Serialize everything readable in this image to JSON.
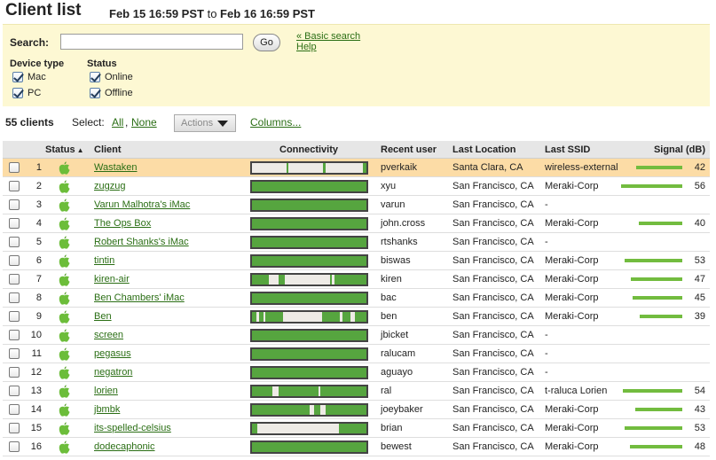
{
  "header": {
    "title": "Client list",
    "date_from": "Feb 15 16:59 PST",
    "date_sep": "to",
    "date_to": "Feb 16 16:59 PST"
  },
  "search": {
    "label": "Search:",
    "value": "",
    "go_label": "Go",
    "basic_search_link": "« Basic search",
    "help_link": "Help"
  },
  "filters": {
    "device_type": {
      "title": "Device type",
      "options": [
        {
          "label": "Mac",
          "checked": true
        },
        {
          "label": "PC",
          "checked": true
        }
      ]
    },
    "status": {
      "title": "Status",
      "options": [
        {
          "label": "Online",
          "checked": true
        },
        {
          "label": "Offline",
          "checked": true
        }
      ]
    }
  },
  "toolbar": {
    "count": "55 clients",
    "select_label": "Select:",
    "select_all": "All",
    "select_none": "None",
    "actions_label": "Actions",
    "columns_link": "Columns..."
  },
  "columns": {
    "status": "Status",
    "sort_arrow": "▲",
    "client": "Client",
    "connectivity": "Connectivity",
    "recent_user": "Recent user",
    "last_location": "Last Location",
    "last_ssid": "Last SSID",
    "signal": "Signal (dB)"
  },
  "colors": {
    "link": "#2a6e14",
    "online_green": "#56a53f",
    "signal_green": "#72bc3f",
    "selected_row": "#fcdca6",
    "panel": "#fdf8d3"
  },
  "status_icon": "apple-icon",
  "rows": [
    {
      "num": "1",
      "client": "Wastaken",
      "user": "pverkaik",
      "location": "Santa Clara, CA",
      "ssid": "wireless-external",
      "signal": "42",
      "selected": true,
      "gaps": [
        [
          0.0,
          0.3
        ],
        [
          0.32,
          0.62
        ],
        [
          0.64,
          0.97
        ]
      ]
    },
    {
      "num": "2",
      "client": "zugzug",
      "user": "xyu",
      "location": "San Francisco, CA",
      "ssid": "Meraki-Corp",
      "signal": "56",
      "gaps": []
    },
    {
      "num": "3",
      "client": "Varun Malhotra's iMac",
      "user": "varun",
      "location": "San Francisco, CA",
      "ssid": "-",
      "signal": "",
      "gaps": []
    },
    {
      "num": "4",
      "client": "The Ops Box",
      "user": "john.cross",
      "location": "San Francisco, CA",
      "ssid": "Meraki-Corp",
      "signal": "40",
      "gaps": []
    },
    {
      "num": "5",
      "client": "Robert Shanks's iMac",
      "user": "rtshanks",
      "location": "San Francisco, CA",
      "ssid": "-",
      "signal": "",
      "gaps": []
    },
    {
      "num": "6",
      "client": "tintin",
      "user": "biswas",
      "location": "San Francisco, CA",
      "ssid": "Meraki-Corp",
      "signal": "53",
      "gaps": []
    },
    {
      "num": "7",
      "client": "kiren-air",
      "user": "kiren",
      "location": "San Francisco, CA",
      "ssid": "Meraki-Corp",
      "signal": "47",
      "gaps": [
        [
          0.15,
          0.23
        ],
        [
          0.29,
          0.68
        ],
        [
          0.7,
          0.72
        ]
      ]
    },
    {
      "num": "8",
      "client": "Ben Chambers' iMac",
      "user": "bac",
      "location": "San Francisco, CA",
      "ssid": "Meraki-Corp",
      "signal": "45",
      "gaps": []
    },
    {
      "num": "9",
      "client": "Ben",
      "user": "ben",
      "location": "San Francisco, CA",
      "ssid": "Meraki-Corp",
      "signal": "39",
      "gaps": [
        [
          0.04,
          0.06
        ],
        [
          0.1,
          0.12
        ],
        [
          0.27,
          0.61
        ],
        [
          0.77,
          0.79
        ],
        [
          0.86,
          0.9
        ]
      ]
    },
    {
      "num": "10",
      "client": "screen",
      "user": "jbicket",
      "location": "San Francisco, CA",
      "ssid": "-",
      "signal": "",
      "gaps": []
    },
    {
      "num": "11",
      "client": "pegasus",
      "user": "ralucam",
      "location": "San Francisco, CA",
      "ssid": "-",
      "signal": "",
      "gaps": []
    },
    {
      "num": "12",
      "client": "negatron",
      "user": "aguayo",
      "location": "San Francisco, CA",
      "ssid": "-",
      "signal": "",
      "gaps": []
    },
    {
      "num": "13",
      "client": "lorien",
      "user": "ral",
      "location": "San Francisco, CA",
      "ssid": "t-raluca Lorien",
      "signal": "54",
      "gaps": [
        [
          0.18,
          0.23
        ],
        [
          0.58,
          0.6
        ]
      ]
    },
    {
      "num": "14",
      "client": "jbmbk",
      "user": "joeybaker",
      "location": "San Francisco, CA",
      "ssid": "Meraki-Corp",
      "signal": "43",
      "gaps": [
        [
          0.5,
          0.54
        ],
        [
          0.6,
          0.64
        ]
      ]
    },
    {
      "num": "15",
      "client": "its-spelled-celsius",
      "user": "brian",
      "location": "San Francisco, CA",
      "ssid": "Meraki-Corp",
      "signal": "53",
      "gaps": [
        [
          0.05,
          0.76
        ]
      ]
    },
    {
      "num": "16",
      "client": "dodecaphonic",
      "user": "bewest",
      "location": "San Francisco, CA",
      "ssid": "Meraki-Corp",
      "signal": "48",
      "gaps": []
    }
  ]
}
